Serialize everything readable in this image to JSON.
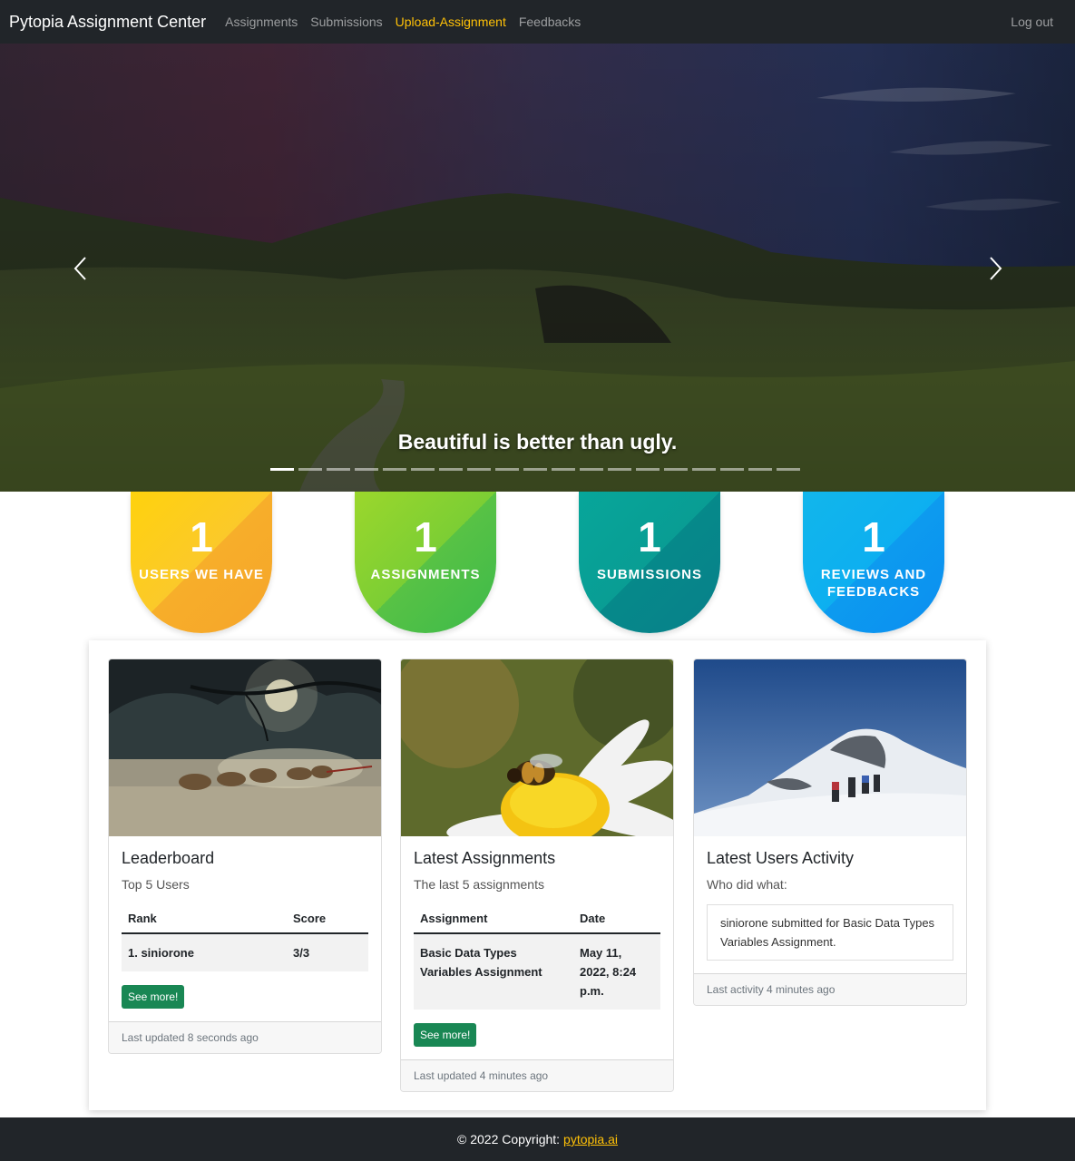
{
  "navbar": {
    "brand": "Pytopia Assignment Center",
    "links": [
      "Assignments",
      "Submissions",
      "Upload-Assignment",
      "Feedbacks"
    ],
    "logout": "Log out"
  },
  "hero": {
    "caption": "Beautiful is better than ugly.",
    "slide_count": 19,
    "active_slide": 1
  },
  "stats": [
    {
      "value": "1",
      "label": "USERS WE HAVE"
    },
    {
      "value": "1",
      "label": "ASSIGNMENTS"
    },
    {
      "value": "1",
      "label": "SUBMISSIONS"
    },
    {
      "value": "1",
      "label": "REVIEWS AND FEEDBACKS"
    }
  ],
  "leaderboard": {
    "title": "Leaderboard",
    "subtitle": "Top 5 Users",
    "columns": [
      "Rank",
      "Score"
    ],
    "rows": [
      {
        "rank": "1. siniorone",
        "score": "3/3"
      }
    ],
    "button": "See more!",
    "footer": "Last updated 8 seconds ago"
  },
  "assignments": {
    "title": "Latest Assignments",
    "subtitle": "The last 5 assignments",
    "columns": [
      "Assignment",
      "Date"
    ],
    "rows": [
      {
        "assignment": "Basic Data Types Variables Assignment",
        "date": "May 11, 2022, 8:24 p.m."
      }
    ],
    "button": "See more!",
    "footer": "Last updated 4 minutes ago"
  },
  "activity": {
    "title": "Latest Users Activity",
    "subtitle": "Who did what:",
    "items": [
      "siniorone submitted for Basic Data Types Variables Assignment."
    ],
    "footer": "Last activity 4 minutes ago"
  },
  "footer": {
    "text": "© 2022 Copyright:",
    "link": "pytopia.ai"
  },
  "colors": {
    "navbar": "#212529",
    "accent": "#ffc107",
    "button": "#198754"
  }
}
